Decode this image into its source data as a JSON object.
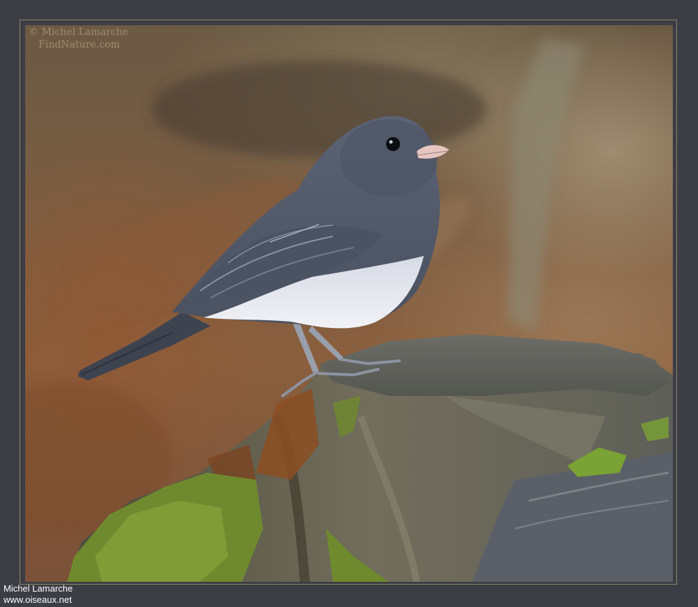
{
  "image": {
    "subject": "bird",
    "watermark": {
      "line1": "© Michel Lamarche",
      "line2": "FindNature.com"
    },
    "credit": {
      "author": "Michel Lamarche",
      "site": "www.oiseaux.net"
    }
  },
  "colors": {
    "background": "#3c3d45",
    "bird_gray": "#5d6675",
    "belly": "#e6e9f0",
    "moss": "#6f8a2e",
    "stump": "#6e6a60"
  }
}
